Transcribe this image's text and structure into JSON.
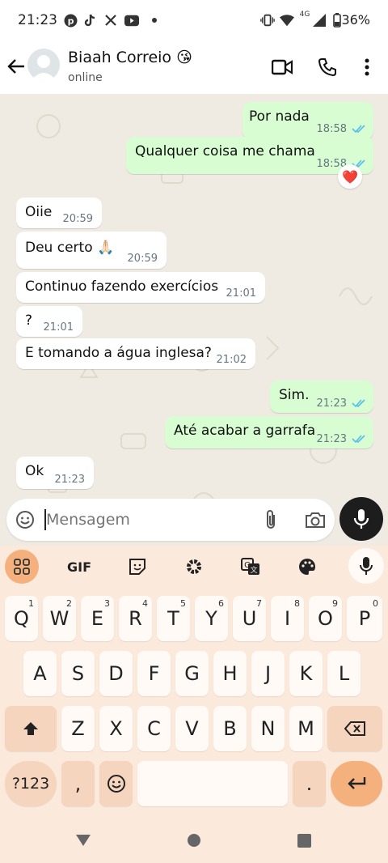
{
  "status_bar": {
    "time": "21:23",
    "network": "4G",
    "battery": "36%"
  },
  "header": {
    "contact_name": "Biaah Correio 😘",
    "contact_status": "online"
  },
  "messages": [
    {
      "text": "Por nada",
      "time": "18:58",
      "direction": "out",
      "ticks": "read"
    },
    {
      "text": "Qualquer coisa me chama",
      "time": "18:58",
      "direction": "out",
      "ticks": "read",
      "reaction": "❤️"
    },
    {
      "text": "Oiie",
      "time": "20:59",
      "direction": "in"
    },
    {
      "text": "Deu certo 🙏🏻",
      "time": "20:59",
      "direction": "in"
    },
    {
      "text": "Continuo fazendo exercícios",
      "time": "21:01",
      "direction": "in"
    },
    {
      "text": "?",
      "time": "21:01",
      "direction": "in"
    },
    {
      "text": "E tomando a água inglesa?",
      "time": "21:02",
      "direction": "in"
    },
    {
      "text": "Sim.",
      "time": "21:23",
      "direction": "out",
      "ticks": "read"
    },
    {
      "text": "Até acabar a garrafa",
      "time": "21:23",
      "direction": "out",
      "ticks": "read"
    },
    {
      "text": "Ok",
      "time": "21:23",
      "direction": "in"
    }
  ],
  "composer": {
    "placeholder": "Mensagem"
  },
  "keyboard": {
    "toolbar": {
      "gif": "GIF"
    },
    "row1": [
      {
        "key": "Q",
        "hint": "1"
      },
      {
        "key": "W",
        "hint": "2"
      },
      {
        "key": "E",
        "hint": "3"
      },
      {
        "key": "R",
        "hint": "4"
      },
      {
        "key": "T",
        "hint": "5"
      },
      {
        "key": "Y",
        "hint": "6"
      },
      {
        "key": "U",
        "hint": "7"
      },
      {
        "key": "I",
        "hint": "8"
      },
      {
        "key": "O",
        "hint": "9"
      },
      {
        "key": "P",
        "hint": "0"
      }
    ],
    "row2": [
      "A",
      "S",
      "D",
      "F",
      "G",
      "H",
      "J",
      "K",
      "L"
    ],
    "row3": [
      "Z",
      "X",
      "C",
      "V",
      "B",
      "N",
      "M"
    ],
    "row4": {
      "symbols": "?123",
      "comma": ",",
      "period": "."
    }
  },
  "colors": {
    "out_bubble": "#d9fdd3",
    "in_bubble": "#ffffff",
    "chat_bg": "#efeae2",
    "read_ticks": "#53bdeb",
    "keyboard_bg": "#fbe9dc",
    "enter_key": "#f4b07d"
  }
}
